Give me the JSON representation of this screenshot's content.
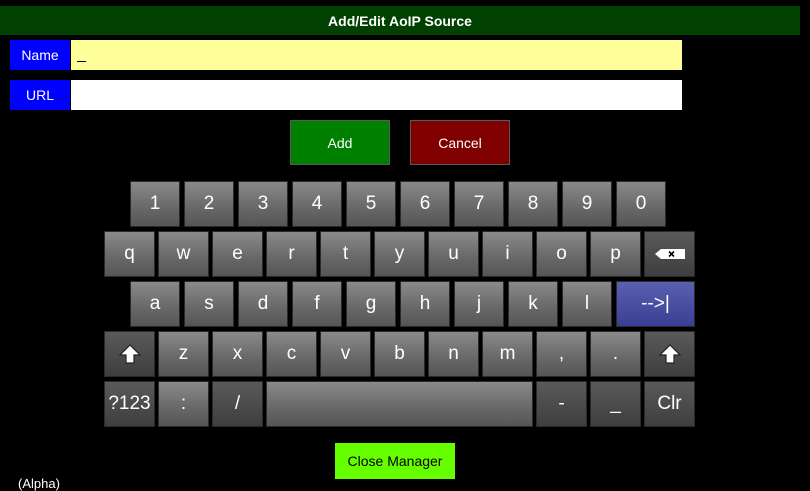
{
  "dialog": {
    "title": "Add/Edit AoIP Source"
  },
  "form": {
    "name_label": "Name",
    "name_value": "_",
    "url_label": "URL",
    "url_value": ""
  },
  "buttons": {
    "add": "Add",
    "cancel": "Cancel",
    "close_manager": "Close Manager"
  },
  "colors": {
    "title_bar": "#004000",
    "field_label": "#0000ff",
    "name_field": "#ffff99",
    "add_button": "#008000",
    "cancel_button": "#800000",
    "close_manager": "#66ff00",
    "tab_key": "#4a4fa8"
  },
  "keyboard": {
    "row_numbers": [
      "1",
      "2",
      "3",
      "4",
      "5",
      "6",
      "7",
      "8",
      "9",
      "0"
    ],
    "row_top": [
      "q",
      "w",
      "e",
      "r",
      "t",
      "y",
      "u",
      "i",
      "o",
      "p"
    ],
    "backspace_icon": "backspace-icon",
    "row_home": [
      "a",
      "s",
      "d",
      "f",
      "g",
      "h",
      "j",
      "k",
      "l"
    ],
    "tab_label": "-->|",
    "shift_icon": "shift-arrow-icon",
    "row_bottom": [
      "z",
      "x",
      "c",
      "v",
      "b",
      "n",
      "m",
      ",",
      "."
    ],
    "row_space": {
      "mode": "?123",
      "colon": ":",
      "slash": "/",
      "dash": "-",
      "underscore": "_",
      "clear": "Clr"
    }
  },
  "footer": {
    "text": "(Alpha)"
  }
}
